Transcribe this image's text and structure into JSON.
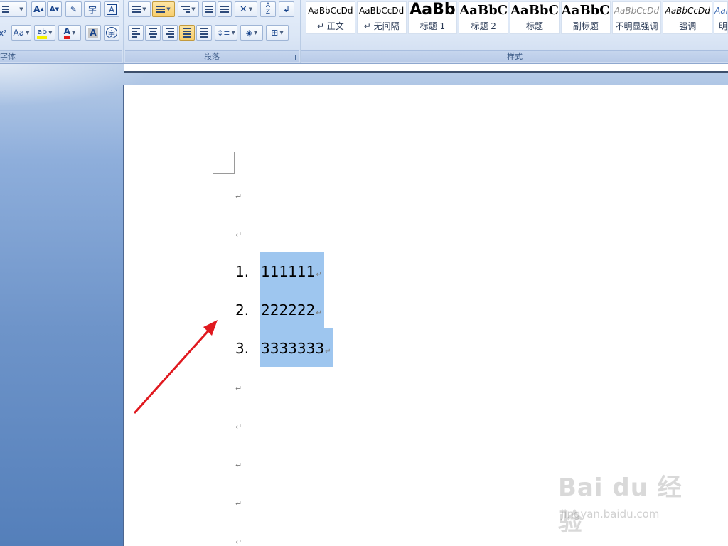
{
  "ribbon": {
    "font_group": {
      "label": "字体",
      "row1": [
        "A",
        "A",
        "字",
        "A"
      ],
      "changecase_label": "Aa",
      "font_color_label": "A",
      "shade_label": "A",
      "enclose_label": "字"
    },
    "paragraph_group": {
      "label": "段落"
    },
    "styles_group": {
      "label": "样式",
      "items": [
        {
          "sample": "AaBbCcDd",
          "name": "↵ 正文"
        },
        {
          "sample": "AaBbCcDd",
          "name": "↵ 无间隔"
        },
        {
          "sample": "AaBb",
          "name": "标题 1"
        },
        {
          "sample": "AaBbC",
          "name": "标题 2"
        },
        {
          "sample": "AaBbC",
          "name": "标题"
        },
        {
          "sample": "AaBbC",
          "name": "副标题"
        },
        {
          "sample": "AaBbCcDd",
          "name": "不明显强调"
        },
        {
          "sample": "AaBbCcDd",
          "name": "强调"
        },
        {
          "sample": "AaBbCcDd",
          "name": "明"
        }
      ]
    }
  },
  "document": {
    "paragraph_mark": "↵",
    "list": [
      {
        "num": "1.",
        "text": "111111"
      },
      {
        "num": "2.",
        "text": "222222"
      },
      {
        "num": "3.",
        "text": "3333333"
      }
    ]
  },
  "watermark": {
    "logo": "Bai du 经验",
    "url": "jingyan.baidu.com"
  },
  "colors": {
    "selection": "#9ec6ef",
    "arrow": "#e0191f",
    "ribbon_text": "#15428b"
  }
}
